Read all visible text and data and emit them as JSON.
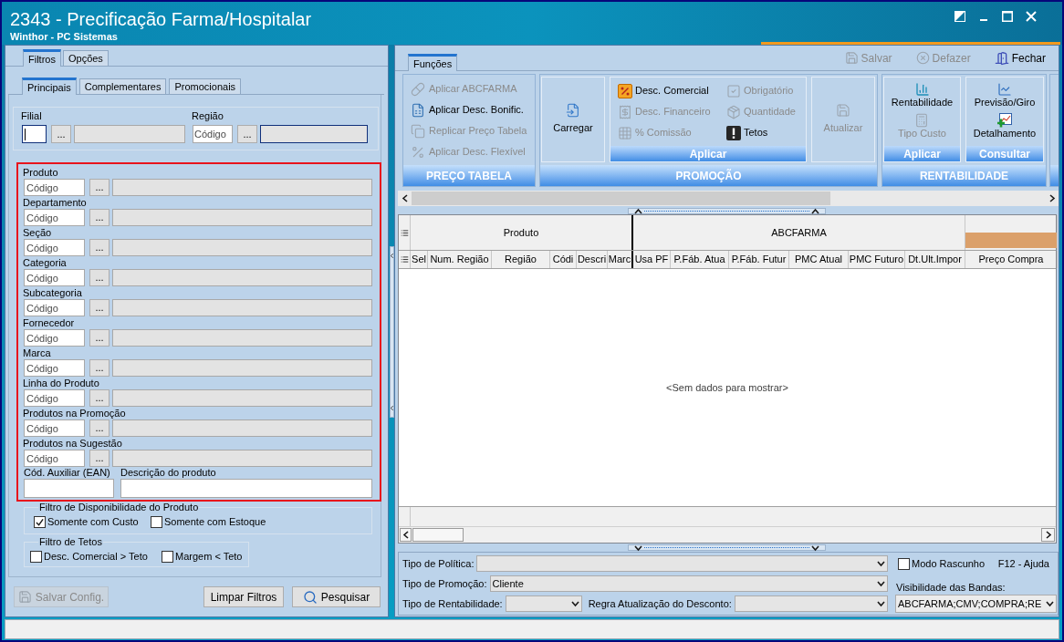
{
  "window": {
    "title": "2343 - Precificação Farma/Hospitalar",
    "subtitle": "Winthor - PC Sistemas"
  },
  "left_panel": {
    "tabs": [
      {
        "label": "Filtros",
        "selected": true
      },
      {
        "label": "Opções",
        "selected": false
      }
    ],
    "subtabs": [
      {
        "label": "Principais",
        "selected": true
      },
      {
        "label": "Complementares",
        "selected": false
      },
      {
        "label": "Promocionais",
        "selected": false
      }
    ],
    "location_filters": [
      {
        "label": "Filial",
        "code": {
          "focused": true
        },
        "button": "...",
        "description": {
          "highlighted": false
        }
      },
      {
        "label": "Região",
        "code": {
          "placeholder": "Código",
          "focused": false
        },
        "button": "...",
        "description": {
          "highlighted": true
        }
      }
    ],
    "product_filter_box": {
      "highlighted": true,
      "filters": [
        {
          "label": "Produto",
          "placeholder": "Código",
          "button": "..."
        },
        {
          "label": "Departamento",
          "placeholder": "Código",
          "button": "..."
        },
        {
          "label": "Seção",
          "placeholder": "Código",
          "button": "..."
        },
        {
          "label": "Categoria",
          "placeholder": "Código",
          "button": "..."
        },
        {
          "label": "Subcategoria",
          "placeholder": "Código",
          "button": "..."
        },
        {
          "label": "Fornecedor",
          "placeholder": "Código",
          "button": "..."
        },
        {
          "label": "Marca",
          "placeholder": "Código",
          "button": "..."
        },
        {
          "label": "Linha do Produto",
          "placeholder": "Código",
          "button": "..."
        },
        {
          "label": "Produtos na Promoção",
          "placeholder": "Código",
          "button": "..."
        },
        {
          "label": "Produtos na Sugestão",
          "placeholder": "Código",
          "button": "..."
        }
      ],
      "extra_fields": [
        {
          "label": "Cód. Auxiliar (EAN)"
        },
        {
          "label": "Descrição do produto"
        }
      ]
    },
    "availability_filter": {
      "title": "Filtro de Disponibilidade do Produto",
      "options": [
        {
          "label": "Somente com Custo",
          "checked": true
        },
        {
          "label": "Somente com Estoque",
          "checked": false
        }
      ]
    },
    "ceiling_filter": {
      "title": "Filtro de Tetos",
      "options": [
        {
          "label": "Desc. Comercial > Teto",
          "checked": false
        },
        {
          "label": "Margem < Teto",
          "checked": false
        }
      ]
    },
    "buttons": [
      {
        "label": "Salvar Config.",
        "kind": "save",
        "disabled": true
      },
      {
        "label": "Limpar Filtros",
        "kind": "plain",
        "disabled": false
      },
      {
        "label": "Pesquisar",
        "kind": "search",
        "disabled": false
      }
    ]
  },
  "right_panel": {
    "tabs": [
      {
        "label": "Funções",
        "selected": true
      }
    ],
    "toolbar": [
      {
        "label": "Salvar",
        "kind": "save",
        "disabled": true
      },
      {
        "label": "Defazer",
        "kind": "undo",
        "disabled": true
      },
      {
        "label": "Fechar",
        "kind": "close",
        "disabled": false
      }
    ],
    "ribbon": [
      {
        "title": "PREÇO TABELA",
        "sections": [
          {
            "kind": "list",
            "items": [
              {
                "label": "Aplicar ABCFARMA",
                "disabled": true
              },
              {
                "label": "Aplicar Desc. Bonific.",
                "disabled": false
              },
              {
                "label": "Replicar Preço Tabela",
                "disabled": true
              },
              {
                "label": "Aplicar Desc. Flexível",
                "disabled": true
              }
            ]
          }
        ]
      },
      {
        "title": "PROMOÇÃO",
        "sections": [
          {
            "kind": "large",
            "items": [
              {
                "label": "Carregar",
                "disabled": false
              }
            ]
          },
          {
            "kind": "grid",
            "title": "Aplicar",
            "items": [
              {
                "label": "Desc. Comercial",
                "disabled": false
              },
              {
                "label": "Obrigatório",
                "disabled": true
              },
              {
                "label": "Desc. Financeiro",
                "disabled": true
              },
              {
                "label": "Quantidade",
                "disabled": true
              },
              {
                "label": "% Comissão",
                "disabled": true
              },
              {
                "label": "Tetos",
                "disabled": false
              }
            ]
          },
          {
            "kind": "large",
            "items": [
              {
                "label": "Atualizar",
                "disabled": true
              }
            ]
          }
        ]
      },
      {
        "title": "RENTABILIDADE",
        "sections": [
          {
            "kind": "stack",
            "title": "Aplicar",
            "items": [
              {
                "label": "Rentabilidade",
                "disabled": false
              },
              {
                "label": "Tipo Custo",
                "disabled": true
              }
            ]
          },
          {
            "kind": "stack",
            "title": "Consultar",
            "items": [
              {
                "label": "Previsão/Giro",
                "disabled": false
              },
              {
                "label": "Detalhamento",
                "disabled": false
              }
            ]
          }
        ]
      }
    ],
    "grid": {
      "bands": [
        {
          "label": "Produto",
          "columns": [
            "Sel",
            "Num. Região",
            "Região",
            "Códi",
            "Descri",
            "Marc"
          ]
        },
        {
          "label": "ABCFARMA",
          "columns": [
            "Usa PF",
            "P.Fáb. Atua",
            "P.Fáb. Futur",
            "PMC Atual",
            "PMC Futuro",
            "Dt.Ult.Impor"
          ]
        },
        {
          "color": "#dba06a",
          "columns": [
            "Preço Compra"
          ]
        }
      ],
      "empty_text": "<Sem dados para mostrar>"
    },
    "options": {
      "rows": [
        {
          "fields": [
            {
              "label": "Tipo de Política:"
            }
          ]
        },
        {
          "fields": [
            {
              "label": "Tipo de Promoção:",
              "value": "Cliente"
            }
          ]
        },
        {
          "fields": [
            {
              "label": "Tipo de Rentabilidade:"
            },
            {
              "label": "Regra Atualização do Desconto:"
            }
          ]
        }
      ],
      "draft_mode": {
        "label": "Modo Rascunho",
        "checked": false
      },
      "help": "F12 - Ajuda",
      "band_visibility": {
        "label": "Visibilidade das Bandas:",
        "value": "ABCFARMA;CMV;COMPRA;RE"
      }
    }
  }
}
